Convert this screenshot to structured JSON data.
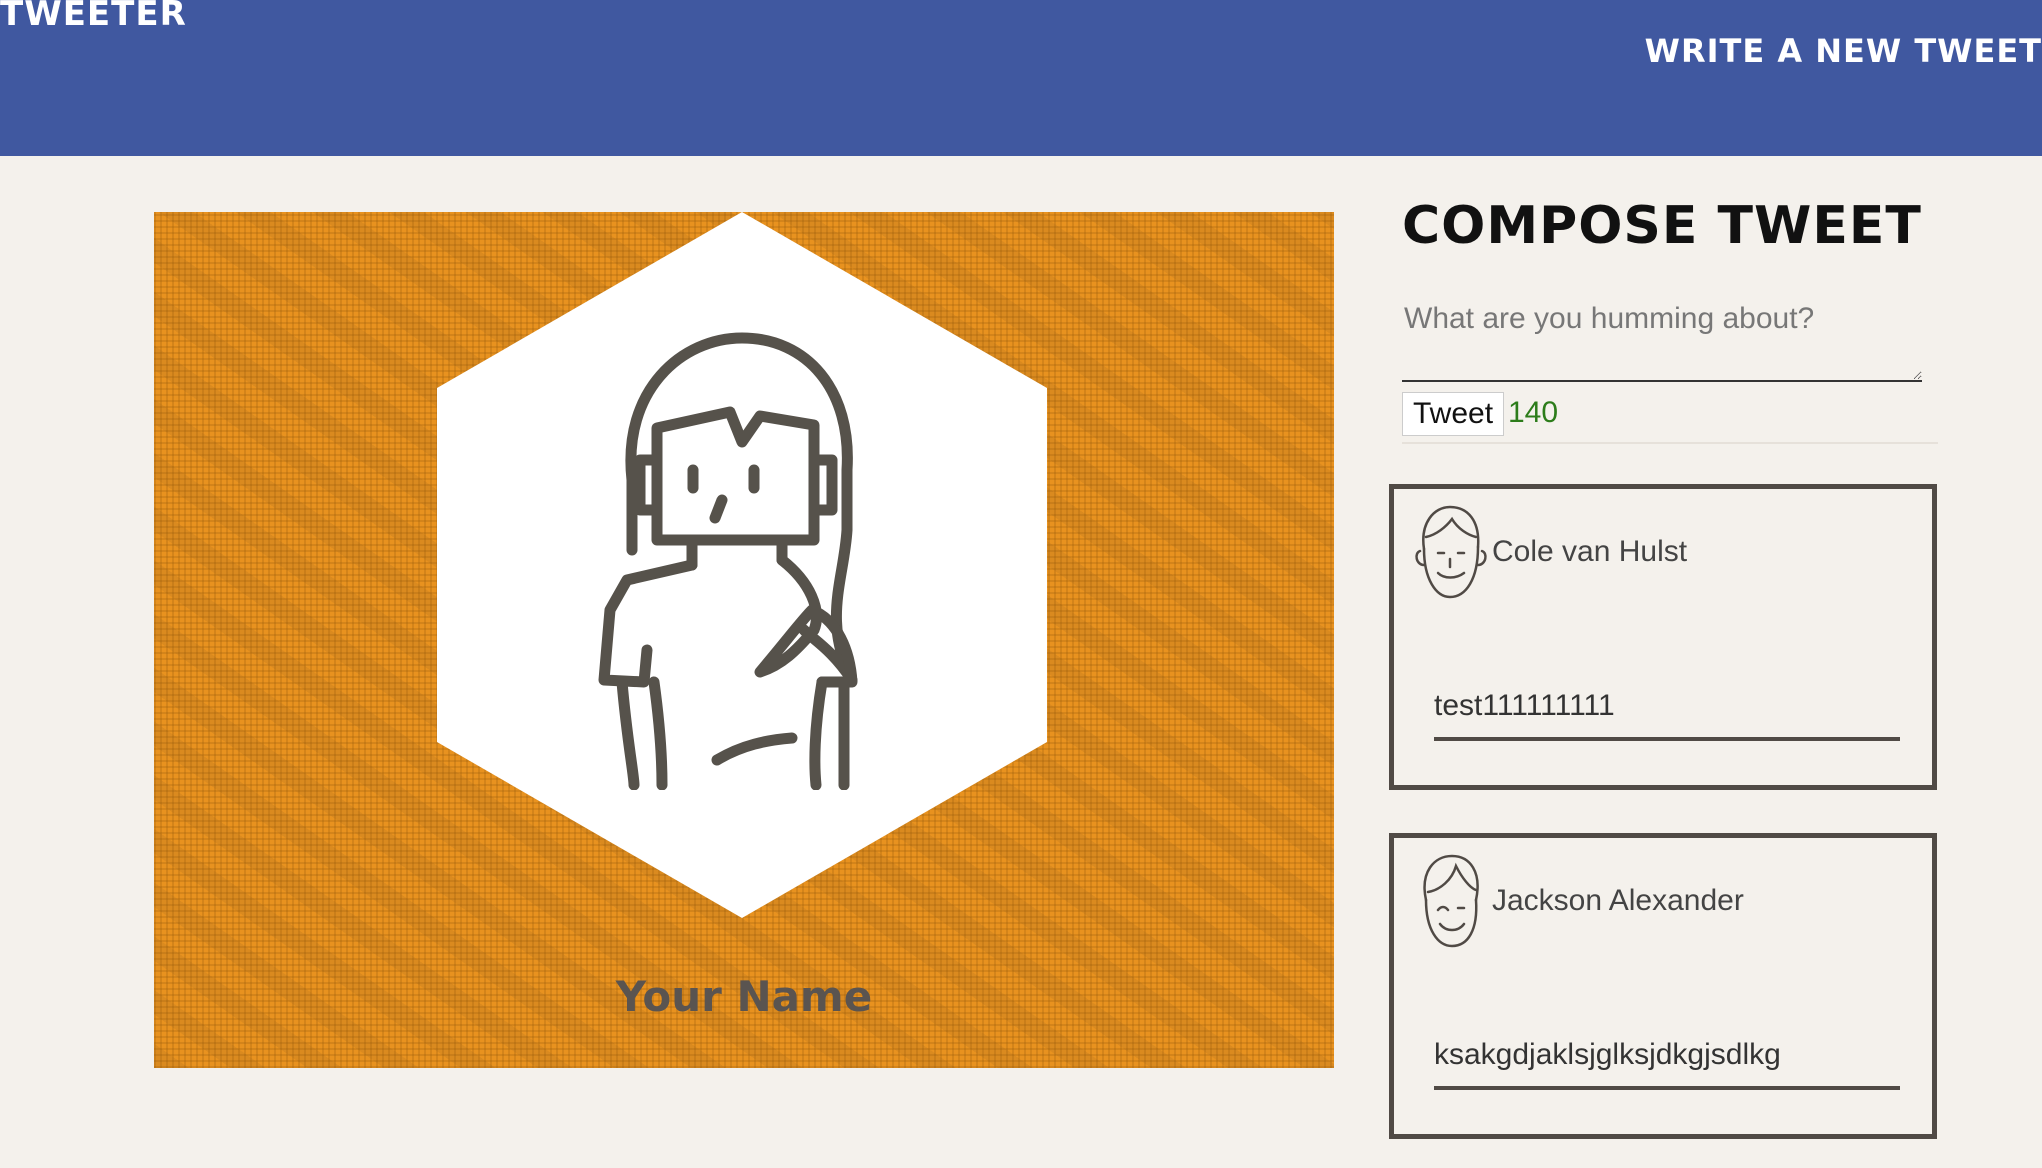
{
  "nav": {
    "brand": "TWEETER",
    "write_link": "WRITE A NEW TWEET"
  },
  "profile": {
    "name": "Your Name",
    "avatar_icon": "female-user-hexagon-icon",
    "background_color": "#e8921f"
  },
  "compose": {
    "title": "COMPOSE TWEET",
    "placeholder": "What are you humming about?",
    "button_label": "Tweet",
    "counter": "140"
  },
  "tweets": [
    {
      "author": "Cole van Hulst",
      "avatar_icon": "male-avatar-icon",
      "text": "test111111111"
    },
    {
      "author": "Jackson Alexander",
      "avatar_icon": "smiling-male-avatar-icon",
      "text": "ksakgdjaklsjglksjdkgjsdlkg"
    }
  ],
  "colors": {
    "nav_bg": "#4058a0",
    "page_bg": "#f4f1ec",
    "counter_green": "#2c7c1a",
    "dark_border": "#504a45"
  }
}
